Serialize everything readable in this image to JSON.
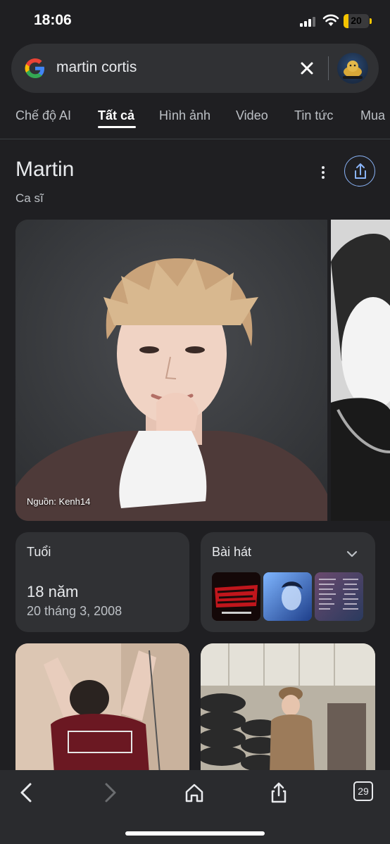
{
  "status_bar": {
    "time": "18:06",
    "battery": "20",
    "battery_level": 0.2
  },
  "search": {
    "query": "martin cortis",
    "icons": [
      "google-logo",
      "clear-icon",
      "account-avatar"
    ]
  },
  "tabs": [
    {
      "label": "Chế độ AI",
      "active": false
    },
    {
      "label": "Tất cả",
      "active": true
    },
    {
      "label": "Hình ảnh",
      "active": false
    },
    {
      "label": "Video",
      "active": false
    },
    {
      "label": "Tin tức",
      "active": false
    },
    {
      "label": "Mua",
      "active": false
    }
  ],
  "knowledge_panel": {
    "title": "Martin",
    "subtitle": "Ca sĩ",
    "image_credit": "Nguồn: Kenh14",
    "age_card": {
      "label": "Tuổi",
      "value": "18 năm",
      "birth_date": "20 tháng 3, 2008"
    },
    "songs_card": {
      "label": "Bài hát",
      "thumbnails": [
        "redred-cover",
        "blue-portrait-cover",
        "tracklist-cover"
      ]
    }
  },
  "toolbar": {
    "tab_count": "29",
    "icons": [
      "back-icon",
      "forward-icon",
      "home-icon",
      "share-icon",
      "tabs-icon"
    ]
  },
  "colors": {
    "background": "#1f1f22",
    "surface": "#303134",
    "accent": "#8ab4f8"
  }
}
